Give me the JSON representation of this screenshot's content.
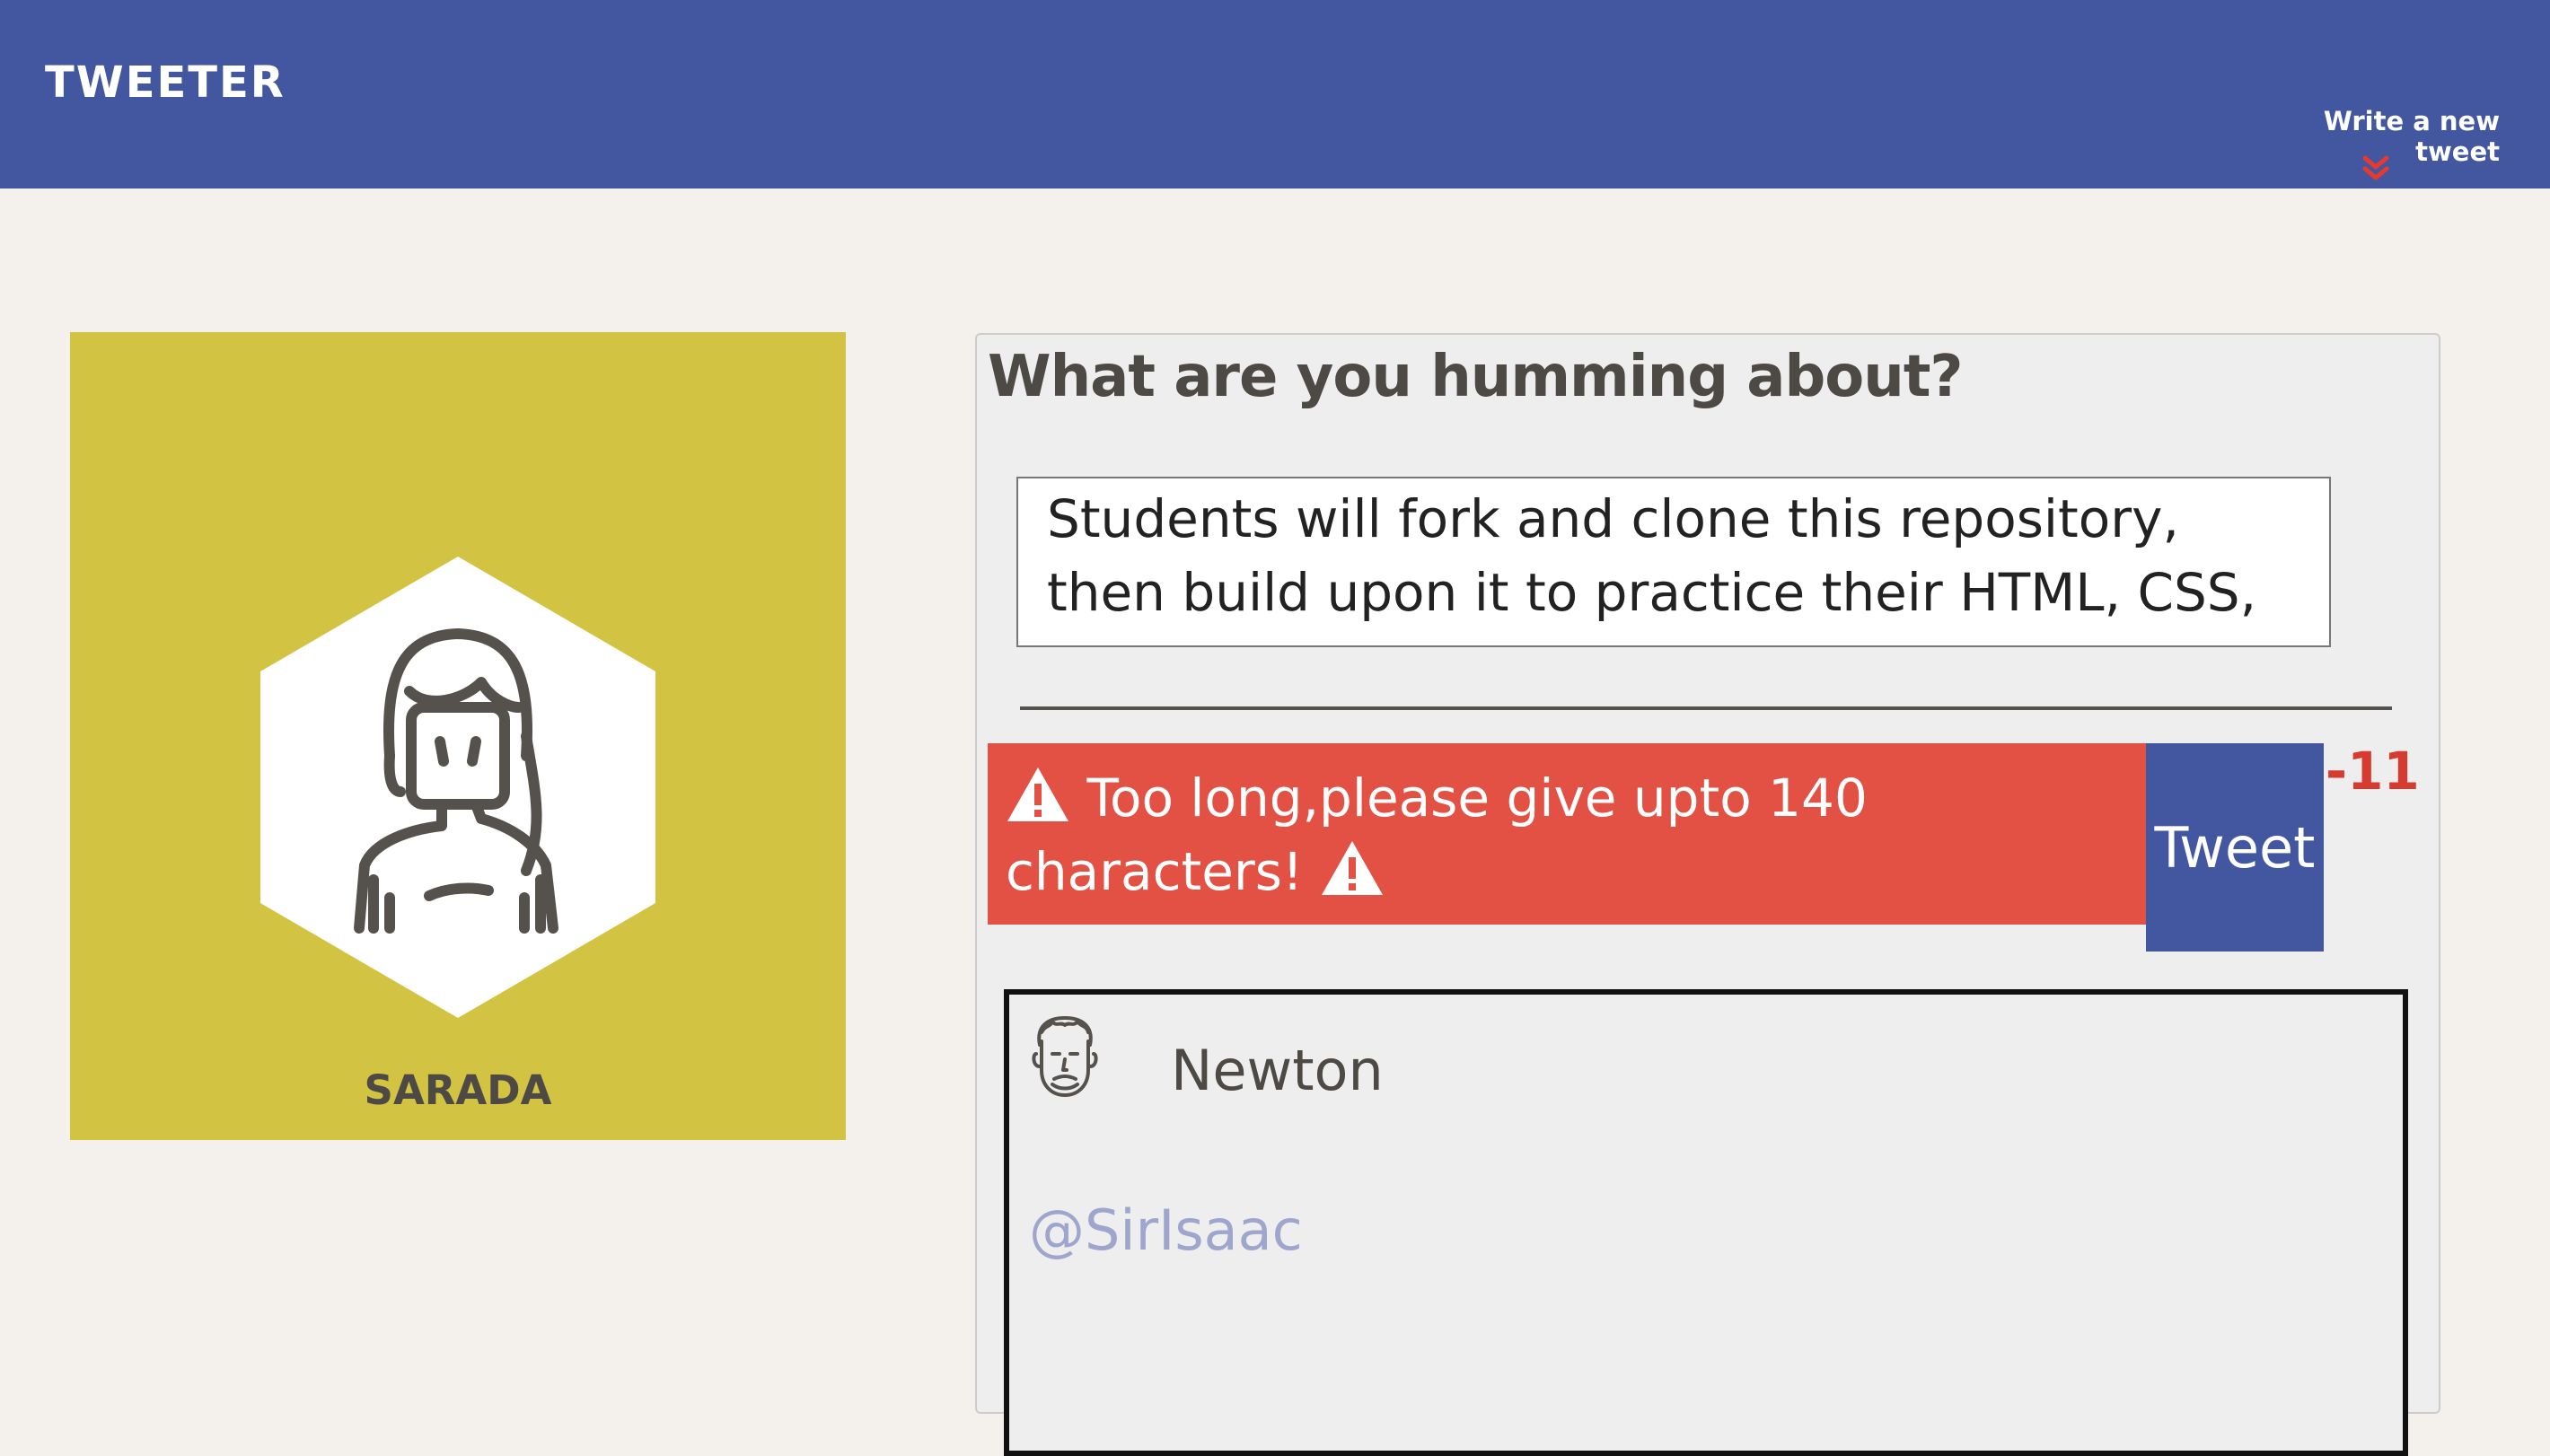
{
  "nav": {
    "brand": "TWEETER",
    "compose_link": "Write a new tweet",
    "compose_icon": "double-chevron-down-icon",
    "icon_color": "#e63a2e"
  },
  "profile": {
    "name": "SARADA",
    "avatar_icon": "girl-avatar-icon",
    "background_color": "#d2c342"
  },
  "composer": {
    "prompt": "What are you humming about?",
    "text": "Students will fork and clone this repository, then build upon it to practice their HTML, CSS, JS,",
    "error_text": "Too long,please give upto 140 characters!",
    "error_icon": "warning-icon",
    "error_color": "#e25143",
    "submit_label": "Tweet",
    "counter": "-11",
    "counter_color": "#d73a2f"
  },
  "tweet": {
    "author_name": "Newton",
    "handle": "@SirIsaac",
    "avatar_icon": "man-avatar-icon"
  },
  "colors": {
    "primary": "#4257a0",
    "page_background": "#f4f1ec"
  }
}
